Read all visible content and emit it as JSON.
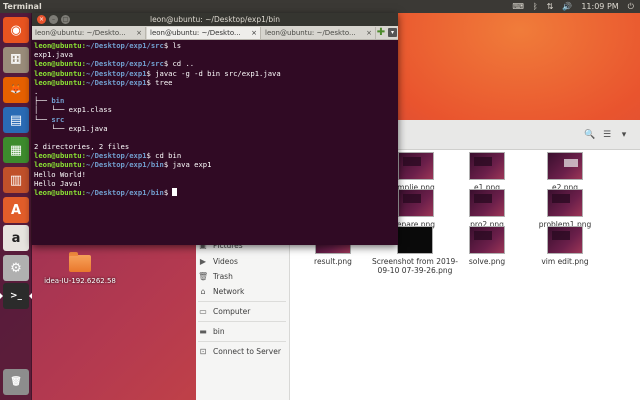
{
  "top_panel": {
    "app_title": "Terminal",
    "clock": "11:09 PM",
    "tray_icons": [
      "keyboard-icon",
      "bluetooth-icon",
      "network-icon",
      "volume-icon",
      "power-icon"
    ]
  },
  "launcher": {
    "items": [
      {
        "name": "dash-home",
        "icon": "ubuntu-logo-icon",
        "color": "#e95420",
        "glyph": "◉"
      },
      {
        "name": "files",
        "icon": "files-icon",
        "color": "#9a8c7a",
        "glyph": "🗄"
      },
      {
        "name": "firefox",
        "icon": "firefox-icon",
        "color": "#e66000",
        "glyph": "🦊"
      },
      {
        "name": "writer",
        "icon": "writer-icon",
        "color": "#2a6bb5",
        "glyph": "▤"
      },
      {
        "name": "calc",
        "icon": "calc-icon",
        "color": "#3d8b2d",
        "glyph": "▦"
      },
      {
        "name": "impress",
        "icon": "impress-icon",
        "color": "#c0502a",
        "glyph": "▥"
      },
      {
        "name": "software",
        "icon": "software-center-icon",
        "color": "#e25d2a",
        "glyph": "A"
      },
      {
        "name": "amazon",
        "icon": "amazon-icon",
        "color": "#e7e4df",
        "glyph": "a"
      },
      {
        "name": "settings",
        "icon": "settings-icon",
        "color": "#b0b0b0",
        "glyph": "⚙"
      },
      {
        "name": "terminal",
        "icon": "terminal-icon",
        "color": "#2b2b2b",
        "glyph": ">_"
      },
      {
        "name": "trash",
        "icon": "trash-icon",
        "color": "#8d8d8d",
        "glyph": "🗑"
      }
    ]
  },
  "desktop": {
    "icons": [
      {
        "label": "idea-IU-192.6262.58"
      }
    ]
  },
  "files": {
    "sidebar": [
      {
        "label": "Pictures",
        "icon": "camera-icon"
      },
      {
        "label": "Videos",
        "icon": "video-icon"
      },
      {
        "label": "Trash",
        "icon": "trash-icon"
      },
      {
        "label": "Network",
        "icon": "network-icon"
      },
      {
        "label": "Computer",
        "icon": "computer-icon"
      },
      {
        "label": "bin",
        "icon": "folder-icon"
      },
      {
        "label": "Connect to Server",
        "icon": "server-icon"
      }
    ],
    "items": [
      {
        "label": "mplie.png"
      },
      {
        "label": "e1.png"
      },
      {
        "label": "e2.png"
      },
      {
        "label": "epare.png"
      },
      {
        "label": "pro2.png"
      },
      {
        "label": "problem1.png"
      },
      {
        "label": "result.png"
      },
      {
        "label": "Screenshot from 2019-09-10 07-39-26.png"
      },
      {
        "label": "solve.png"
      },
      {
        "label": "vim edit.png"
      }
    ]
  },
  "terminal": {
    "title": "leon@ubuntu: ~/Desktop/exp1/bin",
    "tabs": [
      {
        "label": "leon@ubuntu: ~/Deskto...",
        "close": "×"
      },
      {
        "label": "leon@ubuntu: ~/Deskto...",
        "close": "×"
      },
      {
        "label": "leon@ubuntu: ~/Deskto...",
        "close": "×"
      }
    ],
    "prompt_user": "leon@ubuntu",
    "lines": [
      {
        "kind": "prompt",
        "path": "~/Desktop/exp1/src",
        "cmd": "ls"
      },
      {
        "kind": "out",
        "text": "exp1.java"
      },
      {
        "kind": "prompt",
        "path": "~/Desktop/exp1/src",
        "cmd": "cd .."
      },
      {
        "kind": "prompt",
        "path": "~/Desktop/exp1",
        "cmd": "javac -g -d bin src/exp1.java"
      },
      {
        "kind": "prompt",
        "path": "~/Desktop/exp1",
        "cmd": "tree"
      },
      {
        "kind": "out",
        "text": "."
      },
      {
        "kind": "tree",
        "pre": "├── ",
        "dir": "bin",
        "text": ""
      },
      {
        "kind": "out",
        "text": "│   └── exp1.class"
      },
      {
        "kind": "tree",
        "pre": "└── ",
        "dir": "src",
        "text": ""
      },
      {
        "kind": "out",
        "text": "    └── exp1.java"
      },
      {
        "kind": "out",
        "text": ""
      },
      {
        "kind": "out",
        "text": "2 directories, 2 files"
      },
      {
        "kind": "prompt",
        "path": "~/Desktop/exp1",
        "cmd": "cd bin"
      },
      {
        "kind": "prompt",
        "path": "~/Desktop/exp1/bin",
        "cmd": "java exp1"
      },
      {
        "kind": "out",
        "text": "Hello World!"
      },
      {
        "kind": "out",
        "text": "Hello Java!"
      },
      {
        "kind": "prompt",
        "path": "~/Desktop/exp1/bin",
        "cmd": "",
        "cursor": true
      }
    ]
  },
  "colors": {
    "terminal_bg": "#300a24",
    "prompt_user": "#8ae234",
    "prompt_path": "#729fcf",
    "accent": "#e95420"
  }
}
